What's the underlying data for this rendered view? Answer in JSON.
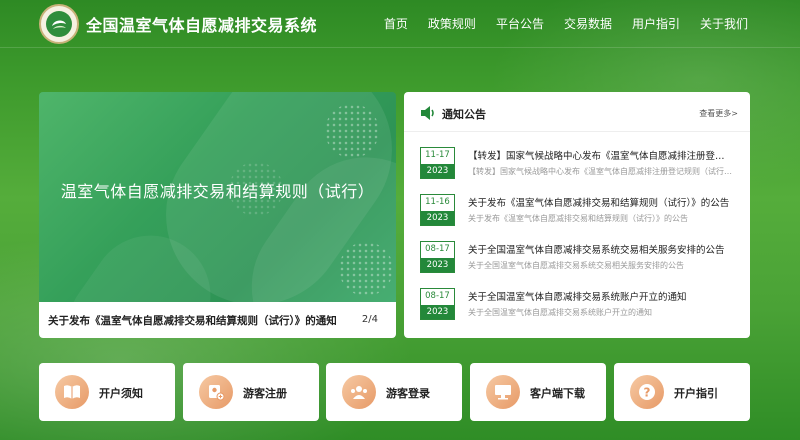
{
  "header": {
    "site_title": "全国温室气体自愿减排交易系统",
    "nav": [
      "首页",
      "政策规则",
      "平台公告",
      "交易数据",
      "用户指引",
      "关于我们"
    ]
  },
  "banner": {
    "headline": "温室气体自愿减排交易和结算规则（试行）",
    "caption": "关于发布《温室气体自愿减排交易和结算规则（试行）》的通知",
    "pager": "2/4"
  },
  "notice": {
    "title": "通知公告",
    "more": "查看更多>",
    "items": [
      {
        "md": "11-17",
        "year": "2023",
        "title": "【转发】国家气候战略中心发布《温室气体自愿减排注册登记规则（试行）》",
        "sub": "【转发】国家气候战略中心发布《温室气体自愿减排注册登记规则（试行）》"
      },
      {
        "md": "11-16",
        "year": "2023",
        "title": "关于发布《温室气体自愿减排交易和结算规则（试行）》的公告",
        "sub": "关于发布《温室气体自愿减排交易和结算规则（试行）》的公告"
      },
      {
        "md": "08-17",
        "year": "2023",
        "title": "关于全国温室气体自愿减排交易系统交易相关服务安排的公告",
        "sub": "关于全国温室气体自愿减排交易系统交易相关服务安排的公告"
      },
      {
        "md": "08-17",
        "year": "2023",
        "title": "关于全国温室气体自愿减排交易系统账户开立的通知",
        "sub": "关于全国温室气体自愿减排交易系统账户开立的通知"
      }
    ]
  },
  "quick_links": [
    {
      "label": "开户须知",
      "icon": "book-icon"
    },
    {
      "label": "游客注册",
      "icon": "user-add-icon"
    },
    {
      "label": "游客登录",
      "icon": "users-icon"
    },
    {
      "label": "客户端下载",
      "icon": "monitor-icon"
    },
    {
      "label": "开户指引",
      "icon": "question-icon"
    }
  ],
  "colors": {
    "brand_green": "#23883a",
    "icon_orange": "#e79a67"
  }
}
